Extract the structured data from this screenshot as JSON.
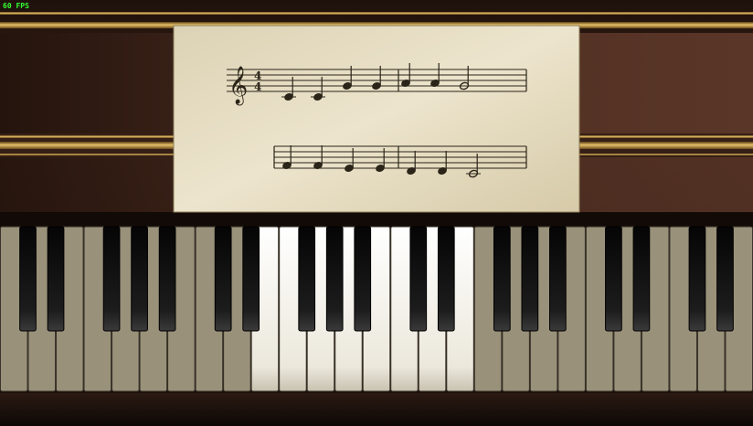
{
  "overlay": {
    "fps_label": "60 FPS",
    "fps_color": "#33ff33"
  },
  "colors": {
    "wood_dark": "#2a1710",
    "wood_mid": "#4a2a1e",
    "gold": "#c9a050",
    "paper": "#e6dcc2",
    "ink": "#2b2418",
    "white_key": "#f2eee2",
    "white_key_dim": "#9a917b",
    "black_key": "#111111"
  },
  "sheet_music": {
    "time_signature": {
      "top": "4",
      "bottom": "4"
    },
    "line1": [
      {
        "pitch": "C4",
        "duration": "quarter"
      },
      {
        "pitch": "C4",
        "duration": "quarter"
      },
      {
        "pitch": "G4",
        "duration": "quarter"
      },
      {
        "pitch": "G4",
        "duration": "quarter"
      },
      {
        "pitch": "A4",
        "duration": "quarter"
      },
      {
        "pitch": "A4",
        "duration": "quarter"
      },
      {
        "pitch": "G4",
        "duration": "half"
      }
    ],
    "line2": [
      {
        "pitch": "F4",
        "duration": "quarter"
      },
      {
        "pitch": "F4",
        "duration": "quarter"
      },
      {
        "pitch": "E4",
        "duration": "quarter"
      },
      {
        "pitch": "E4",
        "duration": "quarter"
      },
      {
        "pitch": "D4",
        "duration": "quarter"
      },
      {
        "pitch": "D4",
        "duration": "quarter"
      },
      {
        "pitch": "C4",
        "duration": "half"
      }
    ]
  },
  "keyboard": {
    "white_key_count": 27,
    "highlighted_white_keys": [
      9,
      10,
      11,
      12,
      13,
      14,
      15,
      16
    ]
  }
}
